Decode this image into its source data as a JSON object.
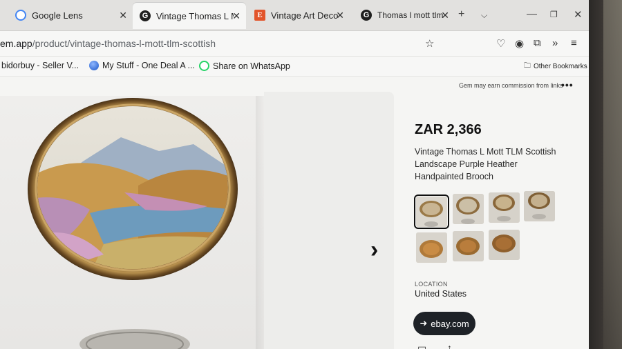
{
  "tabs": [
    {
      "title": "Google Lens",
      "icon": "google-lens-icon"
    },
    {
      "title": "Vintage Thomas L Mo",
      "icon": "gem-icon"
    },
    {
      "title": "Vintage Art Deco Era",
      "icon": "etsy-icon"
    },
    {
      "title": "Thomas l mott tlm - G",
      "icon": "gem-icon"
    }
  ],
  "url": {
    "host": "em.app",
    "path": "/product/vintage-thomas-l-mott-tlm-scottish"
  },
  "bookmarks": [
    {
      "label": "bidorbuy - Seller V..."
    },
    {
      "label": "My Stuff - One Deal A ..."
    },
    {
      "label": "Share on WhatsApp"
    }
  ],
  "other_bookmarks": "Other Bookmarks",
  "product": {
    "commission_note": "Gem may earn commission from links",
    "price": "ZAR 2,366",
    "title": "Vintage Thomas L Mott TLM Scottish Landscape Purple Heather Handpainted Brooch",
    "location_label": "LOCATION",
    "location": "United States",
    "source_button": "ebay.com"
  },
  "colors": {
    "accent_dark": "#1e2227",
    "tab_active": "#f6f6f5"
  }
}
